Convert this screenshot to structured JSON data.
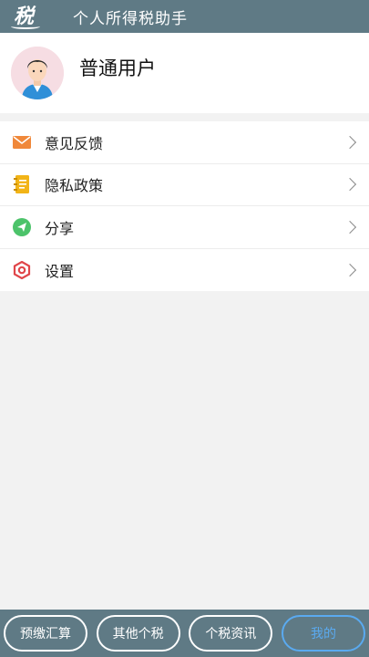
{
  "header": {
    "logo_text": "税",
    "title": "个人所得税助手"
  },
  "profile": {
    "username": "普通用户"
  },
  "menu": [
    {
      "label": "意见反馈",
      "icon": "mail-icon",
      "color": "#f0883a"
    },
    {
      "label": "隐私政策",
      "icon": "notebook-icon",
      "color": "#f2b417"
    },
    {
      "label": "分享",
      "icon": "share-icon",
      "color": "#4cc36a"
    },
    {
      "label": "设置",
      "icon": "settings-icon",
      "color": "#e0464a"
    }
  ],
  "bottom_nav": [
    {
      "label": "预缴汇算",
      "active": false
    },
    {
      "label": "其他个税",
      "active": false
    },
    {
      "label": "个税资讯",
      "active": false
    },
    {
      "label": "我的",
      "active": true
    }
  ],
  "colors": {
    "bar": "#5f7a85",
    "active_tab": "#5aaaf0",
    "background": "#f2f2f2"
  }
}
